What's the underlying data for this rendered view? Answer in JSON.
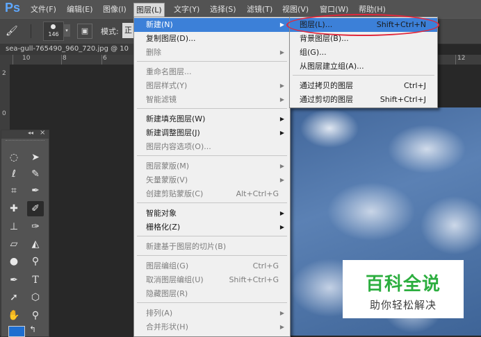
{
  "app": {
    "logo": "Ps"
  },
  "menubar": {
    "items": [
      "文件(F)",
      "编辑(E)",
      "图像(I)",
      "图层(L)",
      "文字(Y)",
      "选择(S)",
      "滤镜(T)",
      "视图(V)",
      "窗口(W)",
      "帮助(H)"
    ],
    "active": "图层(L)"
  },
  "options_bar": {
    "brush_size": "146",
    "mode_label": "模式:",
    "mode_value": "正"
  },
  "document": {
    "tab_title": "sea-gull-765490_960_720.jpg @ 10"
  },
  "ruler": {
    "top_labels": [
      "10",
      "8",
      "6",
      "12"
    ],
    "left_labels": [
      "2",
      "0"
    ]
  },
  "tools_panel": {
    "collapse_glyph": "◂◂",
    "close_glyph": "×"
  },
  "layer_menu": {
    "groups": [
      [
        {
          "label": "新建(N)",
          "submenu": true,
          "highlighted": true
        },
        {
          "label": "复制图层(D)..."
        },
        {
          "label": "删除",
          "submenu": true,
          "disabled": true
        }
      ],
      [
        {
          "label": "重命名图层...",
          "disabled": true
        },
        {
          "label": "图层样式(Y)",
          "submenu": true,
          "disabled": true
        },
        {
          "label": "智能滤镜",
          "submenu": true,
          "disabled": true
        }
      ],
      [
        {
          "label": "新建填充图层(W)",
          "submenu": true
        },
        {
          "label": "新建调整图层(J)",
          "submenu": true
        },
        {
          "label": "图层内容选项(O)...",
          "disabled": true
        }
      ],
      [
        {
          "label": "图层蒙版(M)",
          "submenu": true,
          "disabled": true
        },
        {
          "label": "矢量蒙版(V)",
          "submenu": true,
          "disabled": true
        },
        {
          "label": "创建剪贴蒙版(C)",
          "shortcut": "Alt+Ctrl+G",
          "disabled": true
        }
      ],
      [
        {
          "label": "智能对象",
          "submenu": true
        },
        {
          "label": "栅格化(Z)",
          "submenu": true
        }
      ],
      [
        {
          "label": "新建基于图层的切片(B)",
          "disabled": true
        }
      ],
      [
        {
          "label": "图层编组(G)",
          "shortcut": "Ctrl+G",
          "disabled": true
        },
        {
          "label": "取消图层编组(U)",
          "shortcut": "Shift+Ctrl+G",
          "disabled": true
        },
        {
          "label": "隐藏图层(R)",
          "disabled": true
        }
      ],
      [
        {
          "label": "排列(A)",
          "submenu": true,
          "disabled": true
        },
        {
          "label": "合并形状(H)",
          "submenu": true,
          "disabled": true
        }
      ]
    ]
  },
  "new_submenu": {
    "groups": [
      [
        {
          "label": "图层(L)...",
          "shortcut": "Shift+Ctrl+N",
          "highlighted": true
        },
        {
          "label": "背景图层(B)..."
        },
        {
          "label": "组(G)..."
        },
        {
          "label": "从图层建立组(A)...",
          "disabled": true
        }
      ],
      [
        {
          "label": "通过拷贝的图层",
          "shortcut": "Ctrl+J"
        },
        {
          "label": "通过剪切的图层",
          "shortcut": "Shift+Ctrl+J",
          "disabled": true
        }
      ]
    ]
  },
  "watermark": {
    "title": "百科全说",
    "subtitle": "助你轻松解决"
  },
  "colors": {
    "highlight": "#3c80d8",
    "callout": "#e0283c",
    "watermark_green": "#2cae3f"
  }
}
